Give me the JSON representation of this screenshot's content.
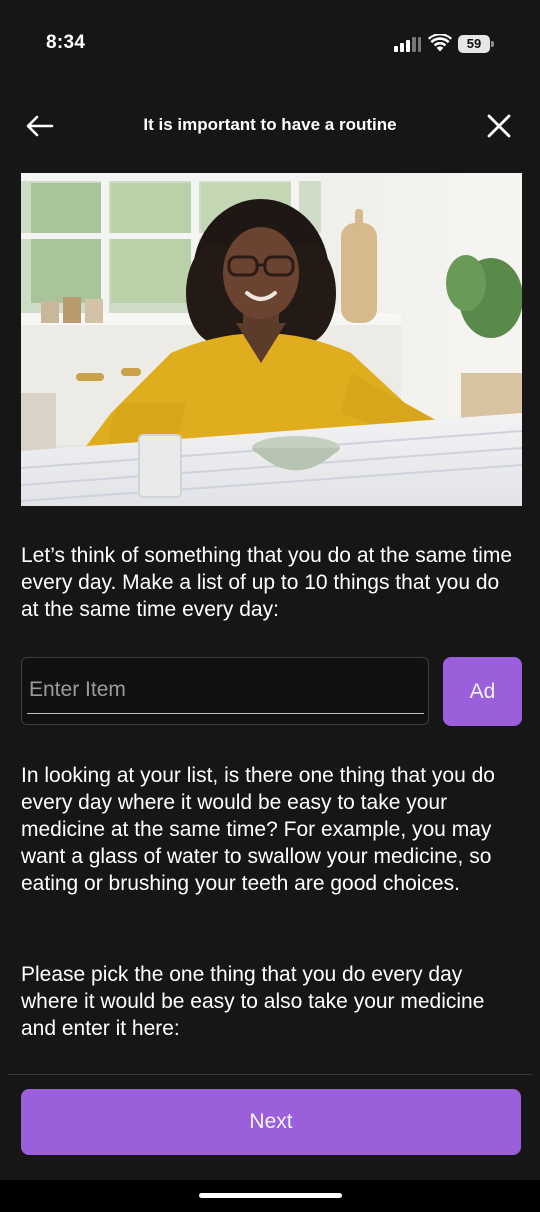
{
  "status_bar": {
    "time": "8:34",
    "battery_level": "59",
    "icons": [
      "signal-icon",
      "wifi-icon",
      "battery-icon"
    ]
  },
  "header": {
    "title": "It is important to have a routine",
    "back_icon": "arrow-left-icon",
    "close_icon": "close-icon"
  },
  "content": {
    "intro_text": "Let’s think of something that you do at the same time every day. Make a list of up to 10 things that you do at the same time every day:",
    "item_input": {
      "placeholder": "Enter Item",
      "value": ""
    },
    "add_button_label": "Ad",
    "question_text": "In looking at your list, is there one thing that you do every day where it would be easy to take your medicine at the same time?  For example, you may want a glass of water to swallow your medicine, so eating or brushing your teeth are good choices.",
    "instruction_text": "Please pick the one thing that you do every day where it would be easy to also take your medicine and enter it here:"
  },
  "footer": {
    "next_button_label": "Next"
  },
  "colors": {
    "background": "#161616",
    "accent": "#9b5fdc",
    "text": "#ffffff"
  }
}
